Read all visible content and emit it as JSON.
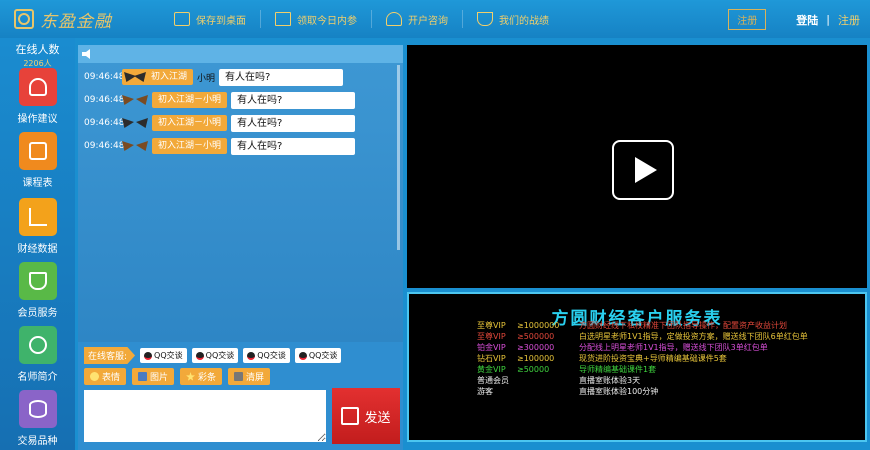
{
  "header": {
    "logo_text": "东盈金融",
    "nav": [
      {
        "label": "保存到桌面",
        "icon": "monitor-icon"
      },
      {
        "label": "领取今日内参",
        "icon": "gift-icon"
      },
      {
        "label": "开户咨询",
        "icon": "headset-icon"
      },
      {
        "label": "我们的战绩",
        "icon": "trophy-icon"
      }
    ],
    "register_box": "注册",
    "login": "登陆",
    "separator": "|",
    "register": "注册"
  },
  "sidebar": {
    "online_title": "在线人数",
    "online_count": "2206人",
    "items": [
      {
        "label": "操作建议",
        "icon": "hand-pointer-icon",
        "color": "#e7423a"
      },
      {
        "label": "课程表",
        "icon": "calendar-icon",
        "color": "#f08a1e"
      },
      {
        "label": "财经数据",
        "icon": "chart-icon",
        "color": "#f3a21b"
      },
      {
        "label": "会员服务",
        "icon": "handshake-icon",
        "color": "#59b947"
      },
      {
        "label": "名师简介",
        "icon": "user-icon",
        "color": "#3fb36b"
      },
      {
        "label": "交易品种",
        "icon": "database-icon",
        "color": "#8a64c8"
      }
    ]
  },
  "chat": {
    "messages": [
      {
        "time": "09:46:48",
        "tag": "初入江湖",
        "user": "小明",
        "text": "有人在吗?",
        "wing": "gold"
      },
      {
        "time": "09:46:48",
        "tag": "初入江湖－小明",
        "user": "",
        "text": "有人在吗?",
        "wing": "gold"
      },
      {
        "time": "09:46:48",
        "tag": "初入江湖－小明",
        "user": "",
        "text": "有人在吗?",
        "wing": "dark"
      },
      {
        "time": "09:46:48",
        "tag": "初入江湖－小明",
        "user": "",
        "text": "有人在吗?",
        "wing": "gold"
      }
    ],
    "kefu_label": "在线客服:",
    "qq_buttons": [
      "QQ交谈",
      "QQ交谈",
      "QQ交谈",
      "QQ交谈"
    ],
    "tools": [
      {
        "label": "表情",
        "icon": "emoji-icon"
      },
      {
        "label": "图片",
        "icon": "image-icon"
      },
      {
        "label": "彩条",
        "icon": "star-icon"
      },
      {
        "label": "清屏",
        "icon": "clear-icon"
      }
    ],
    "input_value": "",
    "send_label": "发送"
  },
  "service": {
    "title": "方圆财经客户服务表",
    "rows": [
      {
        "level": "至尊VIP",
        "amount": "≥1000000",
        "desc": "方圆财经线下私校精准下团队指导操作，配置资产收益计划"
      },
      {
        "level": "至尊VIP",
        "amount": "≥500000",
        "desc": "白选明星老师1V1指导，定做投资方案，赠送线下团队6单红包单"
      },
      {
        "level": "铂金VIP",
        "amount": "≥300000",
        "desc": "分配线上明星老师1V1指导，赠送线下团队3单红包单"
      },
      {
        "level": "钻石VIP",
        "amount": "≥100000",
        "desc": "现货进阶投资宝典+导师精编基础课件5套"
      },
      {
        "level": "黄金VIP",
        "amount": "≥50000",
        "desc": "导师精编基础课件1套"
      },
      {
        "level": "普通会员",
        "amount": "",
        "desc": "直播室账体验3天"
      },
      {
        "level": "游客",
        "amount": "",
        "desc": "直播室账体验100分钟"
      }
    ]
  }
}
